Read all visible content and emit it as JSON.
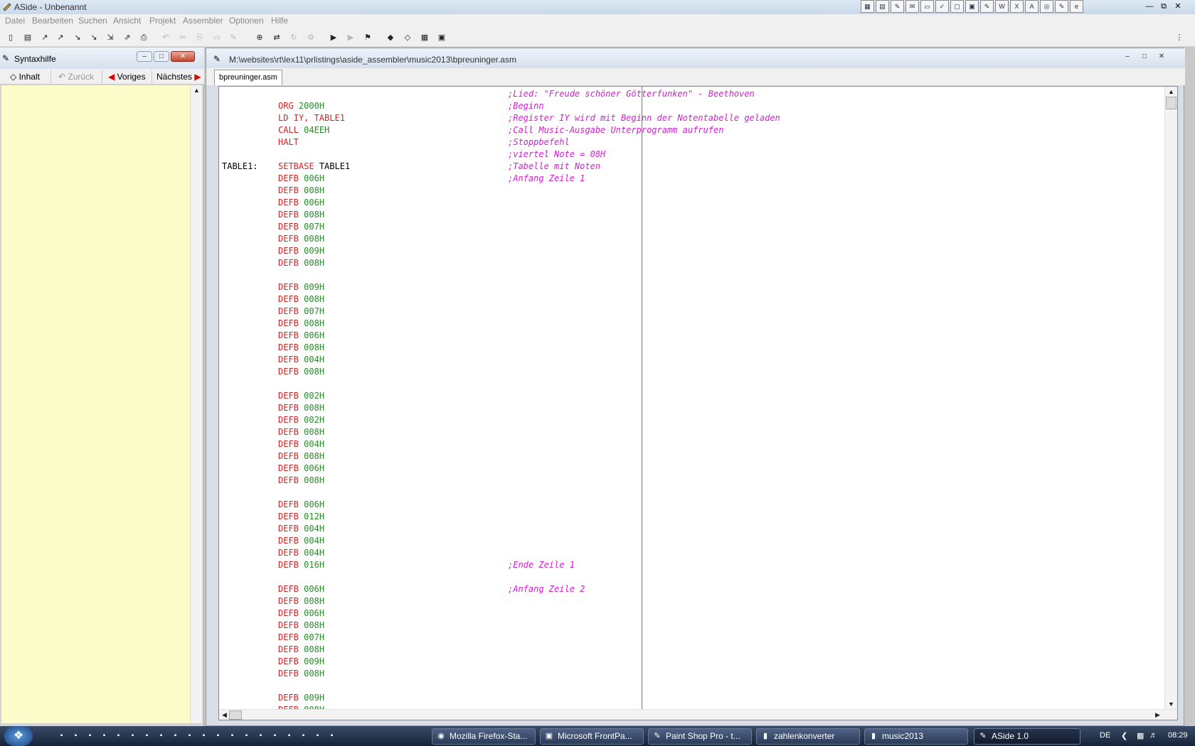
{
  "window": {
    "title": "ASide - Unbenannt"
  },
  "quicklaunch_icons": [
    "app-icon",
    "calc-icon",
    "paint-icon",
    "mail-icon",
    "doc-icon",
    "check-icon",
    "window-icon",
    "files-icon",
    "note-icon",
    "word-icon",
    "excel-icon",
    "access-icon",
    "media-icon",
    "reader-icon",
    "ie-icon"
  ],
  "menu": [
    "Datei",
    "Bearbeiten",
    "Suchen",
    "Ansicht",
    "Projekt",
    "Assembler",
    "Optionen",
    "Hilfe"
  ],
  "toolbar_icons": [
    "new-file-icon",
    "new-doc-icon",
    "open-icon",
    "open-project-icon",
    "save-icon",
    "save-all-icon",
    "save-project-icon",
    "export-icon",
    "print-icon",
    "undo-icon",
    "cut-icon",
    "copy-icon",
    "paste-icon",
    "edit-icon",
    "find-icon",
    "replace-icon",
    "refresh-icon",
    "settings-icon",
    "folder-run-icon",
    "run-icon",
    "debug-icon",
    "book-icon",
    "help-icon",
    "assemble-icon",
    "exit-icon"
  ],
  "syntax_panel": {
    "title": "Syntaxhilfe",
    "nav": {
      "inhalt": "Inhalt",
      "zurueck": "Zurück",
      "voriges": "Voriges",
      "naechstes": "Nächstes"
    }
  },
  "editor": {
    "path": "M:\\websites\\rt\\lex11\\prlistings\\aside_assembler\\music2013\\bpreuninger.asm",
    "tab": "bpreuninger.asm",
    "lines": [
      {
        "label": "",
        "kw": "",
        "op": "",
        "comment": ";Lied: \"Freude schöner Götterfunken\" - Beethoven"
      },
      {
        "label": "",
        "kw": "ORG",
        "op": "2000H",
        "comment": ";Beginn"
      },
      {
        "label": "",
        "kw": "LD",
        "op": "IY, TABLE1",
        "comment": ";Register IY wird mit Beginn der Notentabelle geladen"
      },
      {
        "label": "",
        "kw": "CALL",
        "op": "04EEH",
        "comment": ";Call Music-Ausgabe Unterprogramm aufrufen"
      },
      {
        "label": "",
        "kw": "HALT",
        "op": "",
        "comment": ";Stoppbefehl"
      },
      {
        "label": "",
        "kw": "",
        "op": "",
        "comment": ";viertel Note = 08H"
      },
      {
        "label": "TABLE1:",
        "kw": "SETBASE",
        "op": "TABLE1",
        "comment": ";Tabelle mit Noten"
      },
      {
        "label": "",
        "kw": "DEFB",
        "op": "006H",
        "comment": ";Anfang Zeile 1"
      },
      {
        "label": "",
        "kw": "DEFB",
        "op": "008H",
        "comment": ""
      },
      {
        "label": "",
        "kw": "DEFB",
        "op": "006H",
        "comment": ""
      },
      {
        "label": "",
        "kw": "DEFB",
        "op": "008H",
        "comment": ""
      },
      {
        "label": "",
        "kw": "DEFB",
        "op": "007H",
        "comment": ""
      },
      {
        "label": "",
        "kw": "DEFB",
        "op": "008H",
        "comment": ""
      },
      {
        "label": "",
        "kw": "DEFB",
        "op": "009H",
        "comment": ""
      },
      {
        "label": "",
        "kw": "DEFB",
        "op": "008H",
        "comment": ""
      },
      {
        "label": "",
        "kw": "",
        "op": "",
        "comment": ""
      },
      {
        "label": "",
        "kw": "DEFB",
        "op": "009H",
        "comment": ""
      },
      {
        "label": "",
        "kw": "DEFB",
        "op": "008H",
        "comment": ""
      },
      {
        "label": "",
        "kw": "DEFB",
        "op": "007H",
        "comment": ""
      },
      {
        "label": "",
        "kw": "DEFB",
        "op": "008H",
        "comment": ""
      },
      {
        "label": "",
        "kw": "DEFB",
        "op": "006H",
        "comment": ""
      },
      {
        "label": "",
        "kw": "DEFB",
        "op": "008H",
        "comment": ""
      },
      {
        "label": "",
        "kw": "DEFB",
        "op": "004H",
        "comment": ""
      },
      {
        "label": "",
        "kw": "DEFB",
        "op": "008H",
        "comment": ""
      },
      {
        "label": "",
        "kw": "",
        "op": "",
        "comment": ""
      },
      {
        "label": "",
        "kw": "DEFB",
        "op": "002H",
        "comment": ""
      },
      {
        "label": "",
        "kw": "DEFB",
        "op": "008H",
        "comment": ""
      },
      {
        "label": "",
        "kw": "DEFB",
        "op": "002H",
        "comment": ""
      },
      {
        "label": "",
        "kw": "DEFB",
        "op": "008H",
        "comment": ""
      },
      {
        "label": "",
        "kw": "DEFB",
        "op": "004H",
        "comment": ""
      },
      {
        "label": "",
        "kw": "DEFB",
        "op": "008H",
        "comment": ""
      },
      {
        "label": "",
        "kw": "DEFB",
        "op": "006H",
        "comment": ""
      },
      {
        "label": "",
        "kw": "DEFB",
        "op": "008H",
        "comment": ""
      },
      {
        "label": "",
        "kw": "",
        "op": "",
        "comment": ""
      },
      {
        "label": "",
        "kw": "DEFB",
        "op": "006H",
        "comment": ""
      },
      {
        "label": "",
        "kw": "DEFB",
        "op": "012H",
        "comment": ""
      },
      {
        "label": "",
        "kw": "DEFB",
        "op": "004H",
        "comment": ""
      },
      {
        "label": "",
        "kw": "DEFB",
        "op": "004H",
        "comment": ""
      },
      {
        "label": "",
        "kw": "DEFB",
        "op": "004H",
        "comment": ""
      },
      {
        "label": "",
        "kw": "DEFB",
        "op": "016H",
        "comment": ";Ende Zeile 1"
      },
      {
        "label": "",
        "kw": "",
        "op": "",
        "comment": ""
      },
      {
        "label": "",
        "kw": "DEFB",
        "op": "006H",
        "comment": ";Anfang Zeile 2"
      },
      {
        "label": "",
        "kw": "DEFB",
        "op": "008H",
        "comment": ""
      },
      {
        "label": "",
        "kw": "DEFB",
        "op": "006H",
        "comment": ""
      },
      {
        "label": "",
        "kw": "DEFB",
        "op": "008H",
        "comment": ""
      },
      {
        "label": "",
        "kw": "DEFB",
        "op": "007H",
        "comment": ""
      },
      {
        "label": "",
        "kw": "DEFB",
        "op": "008H",
        "comment": ""
      },
      {
        "label": "",
        "kw": "DEFB",
        "op": "009H",
        "comment": ""
      },
      {
        "label": "",
        "kw": "DEFB",
        "op": "008H",
        "comment": ""
      },
      {
        "label": "",
        "kw": "",
        "op": "",
        "comment": ""
      },
      {
        "label": "",
        "kw": "DEFB",
        "op": "009H",
        "comment": ""
      },
      {
        "label": "",
        "kw": "DEFB",
        "op": "008H",
        "comment": ""
      }
    ]
  },
  "taskbar": {
    "tasks": [
      {
        "label": "Mozilla Firefox-Sta...",
        "icon": "firefox-icon"
      },
      {
        "label": "Microsoft FrontPa...",
        "icon": "frontpage-icon"
      },
      {
        "label": "Paint Shop Pro - t...",
        "icon": "paintshop-icon"
      },
      {
        "label": "zahlenkonverter",
        "icon": "folder-icon"
      },
      {
        "label": "music2013",
        "icon": "folder-icon"
      },
      {
        "label": "ASide 1.0",
        "icon": "aside-icon"
      }
    ],
    "lang": "DE",
    "clock": "08:29"
  },
  "colors": {
    "keyword": "#d42525",
    "operand": "#2b8a2b",
    "comment": "#d61dd6",
    "help_bg": "#fcfccb"
  }
}
